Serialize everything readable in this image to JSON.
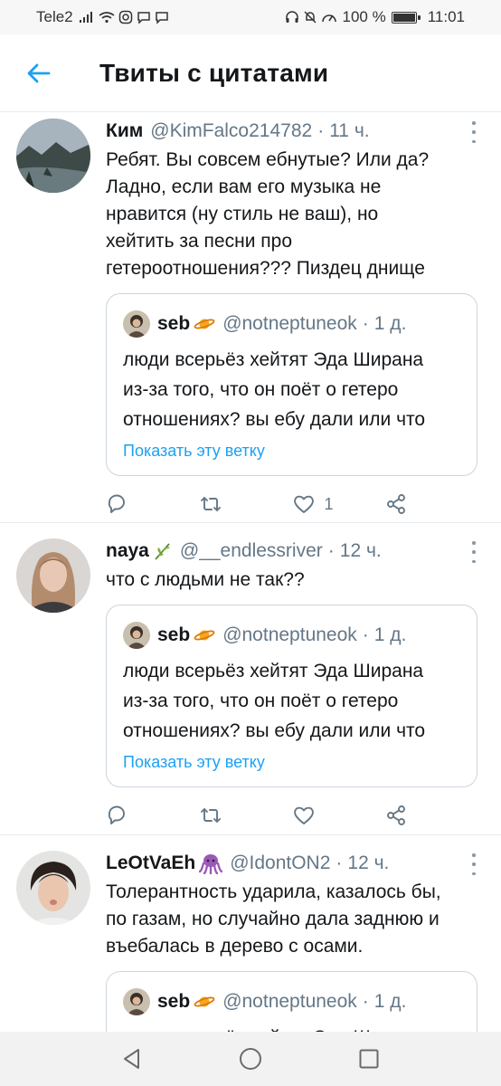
{
  "status_bar": {
    "carrier": "Tele2",
    "battery": "100 %",
    "battery_level": 1.0,
    "time": "11:01",
    "icons": [
      "signal-icon",
      "wifi-icon",
      "instagram-icon",
      "message-icon",
      "message-icon",
      "headphones-icon",
      "mute-icon",
      "speed-icon",
      "battery-icon"
    ]
  },
  "header": {
    "title": "Твиты с цитатами",
    "back_icon": "arrow-left-icon",
    "accent_color": "#1da1f2"
  },
  "quoted_tweet": {
    "name": "seb",
    "handle": "@notneptuneok",
    "time": "1 д.",
    "text": "люди всерьёз хейтят Эда Ширана\nиз-за того, что он поёт о гетеро\nотношениях? вы ебу дали или что",
    "show_thread": "Показать эту ветку"
  },
  "tweets": [
    {
      "name": "Ким",
      "handle": "@KimFalco214782",
      "time": "11 ч.",
      "text": "Ребят. Вы совсем ебнутые? Или да?\nЛадно, если вам его музыка не\nнравится (ну стиль не ваш), но\nхейтить за песни про\nгетероотношения??? Пиздец днище",
      "likes": "1"
    },
    {
      "name": "naya",
      "handle": "@__endlessriver",
      "time": "12 ч.",
      "text": "что с людьми не так??",
      "likes": ""
    },
    {
      "name": "LeOtVaEh",
      "handle": "@IdontON2",
      "time": "12 ч.",
      "text": "Толерантность ударила, казалось бы,\nпо газам, но случайно дала заднюю и\nвъебалась в дерево с осами.",
      "quote_text_partial": "люди всерьёз хейтят Эда Ширана"
    }
  ],
  "dot_separator": "·",
  "nav": [
    "back-triangle-icon",
    "home-circle-icon",
    "recents-square-icon"
  ]
}
